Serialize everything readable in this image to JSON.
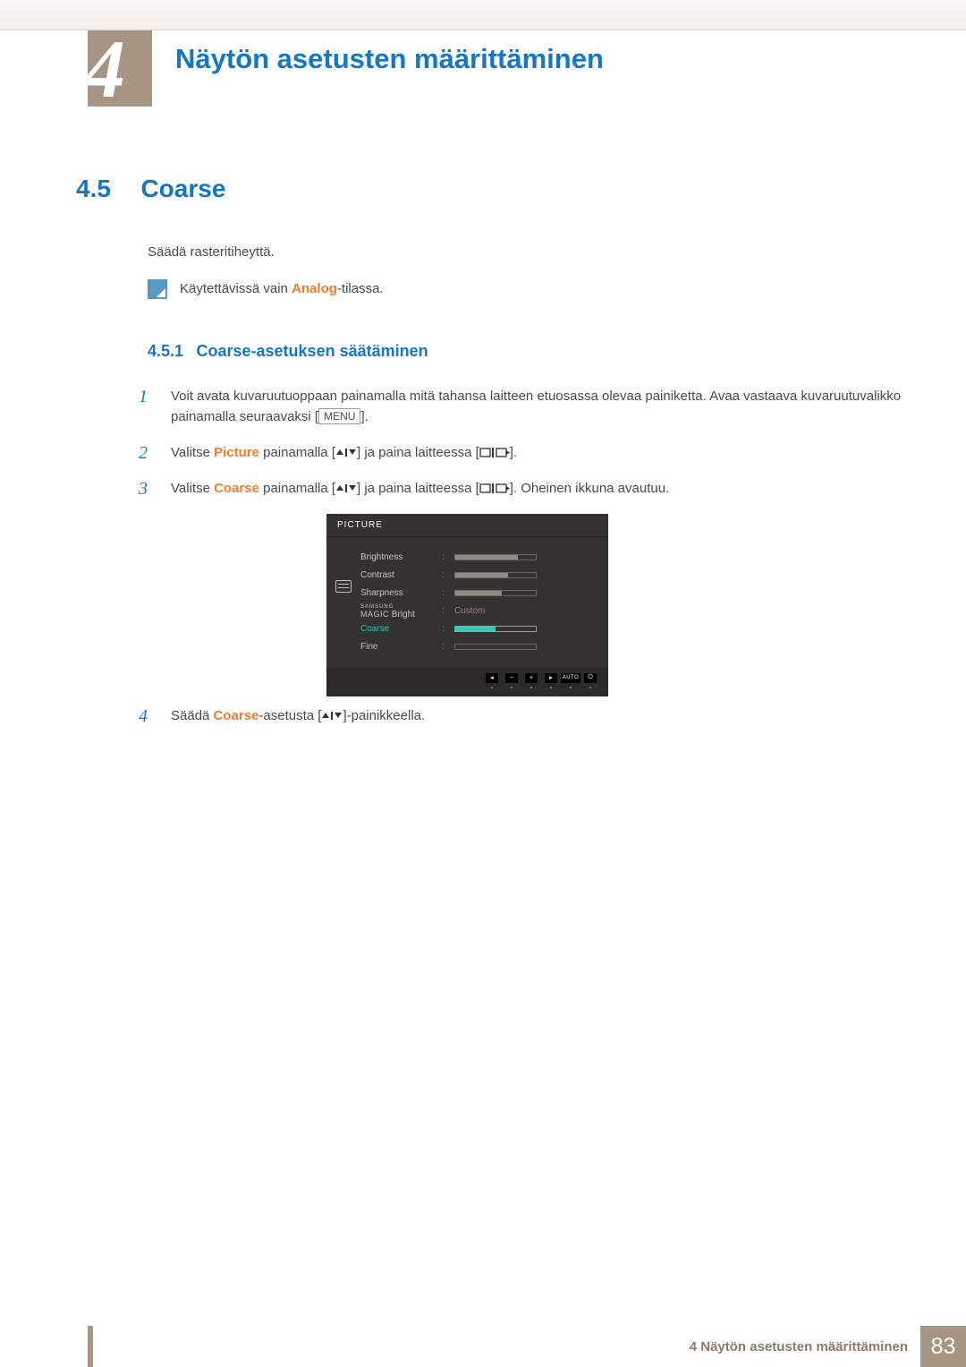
{
  "chapter": {
    "number": "4",
    "title": "Näytön asetusten määrittäminen"
  },
  "section": {
    "number": "4.5",
    "title": "Coarse"
  },
  "intro": "Säädä rasteritiheyttä.",
  "note": {
    "pre": "Käytettävissä vain ",
    "highlight": "Analog",
    "post": "-tilassa."
  },
  "subsection": {
    "number": "4.5.1",
    "title": "Coarse-asetuksen säätäminen"
  },
  "steps": {
    "s1": {
      "num": "1",
      "text_a": "Voit avata kuvaruutuoppaan painamalla mitä tahansa laitteen etuosassa olevaa painiketta. Avaa vastaava kuvaruutuvalikko painamalla seuraavaksi [",
      "menu": "MENU",
      "text_b": "]."
    },
    "s2": {
      "num": "2",
      "text_a": "Valitse ",
      "kw": "Picture",
      "text_b": " painamalla [",
      "text_c": "] ja paina laitteessa [",
      "text_d": "]."
    },
    "s3": {
      "num": "3",
      "text_a": "Valitse ",
      "kw": "Coarse",
      "text_b": " painamalla [",
      "text_c": "] ja paina laitteessa [",
      "text_d": "]. Oheinen ikkuna avautuu."
    },
    "s4": {
      "num": "4",
      "text_a": "Säädä ",
      "kw": "Coarse",
      "text_b": "-asetusta [",
      "text_c": "]-painikkeella."
    }
  },
  "osd": {
    "title": "PICTURE",
    "rows": {
      "brightness": {
        "label": "Brightness",
        "fill": 78
      },
      "contrast": {
        "label": "Contrast",
        "fill": 66
      },
      "sharpness": {
        "label": "Sharpness",
        "fill": 58
      },
      "magic": {
        "small": "SAMSUNG",
        "big": "MAGIC",
        "suffix": " Bright",
        "value": "Custom"
      },
      "coarse": {
        "label": "Coarse",
        "fill": 50
      },
      "fine": {
        "label": "Fine",
        "fill": 0
      }
    },
    "footer": {
      "auto": "AUTO"
    }
  },
  "footer": {
    "label": "4 Näytön asetusten määrittäminen",
    "page": "83"
  }
}
